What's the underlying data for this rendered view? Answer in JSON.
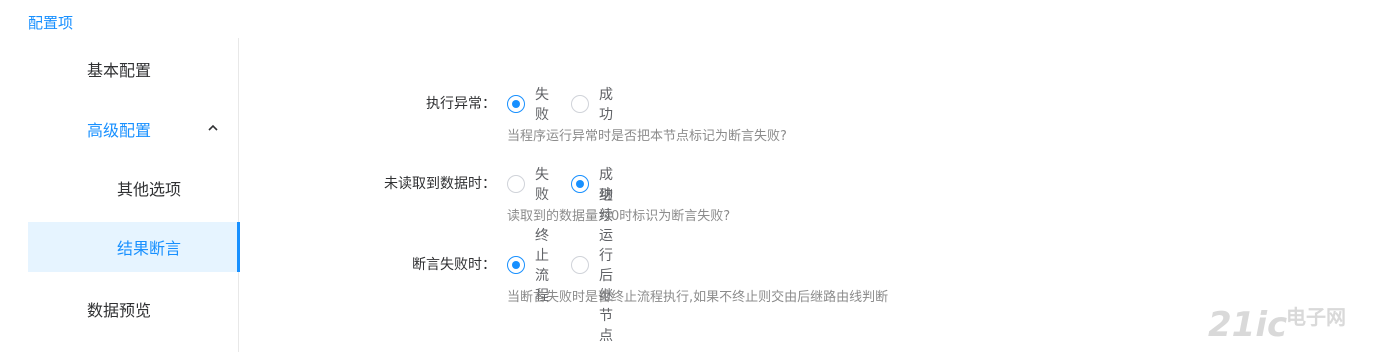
{
  "section_title": "配置项",
  "sidebar": {
    "items": [
      {
        "label": "基本配置"
      },
      {
        "label": "高级配置"
      },
      {
        "label": "其他选项"
      },
      {
        "label": "结果断言"
      },
      {
        "label": "数据预览"
      }
    ]
  },
  "form": {
    "rows": [
      {
        "label": "执行异常：",
        "options": [
          "失败",
          "成功"
        ],
        "selected": "失败",
        "hint": "当程序运行异常时是否把本节点标记为断言失败?"
      },
      {
        "label": "未读取到数据时：",
        "options": [
          "失败",
          "成功"
        ],
        "selected": "成功",
        "hint": "读取到的数据量为0时标识为断言失败?"
      },
      {
        "label": "断言失败时：",
        "options": [
          "终止流程",
          "继续运行后继节点"
        ],
        "selected": "终止流程",
        "hint": "当断言失败时是否终止流程执行,如果不终止则交由后继路由线判断"
      }
    ]
  },
  "watermark": {
    "text_a": "21ic",
    "text_b": "电子网"
  },
  "colors": {
    "accent": "#1890ff",
    "active_bg": "#e6f4ff",
    "hint": "#8c8c8c"
  }
}
